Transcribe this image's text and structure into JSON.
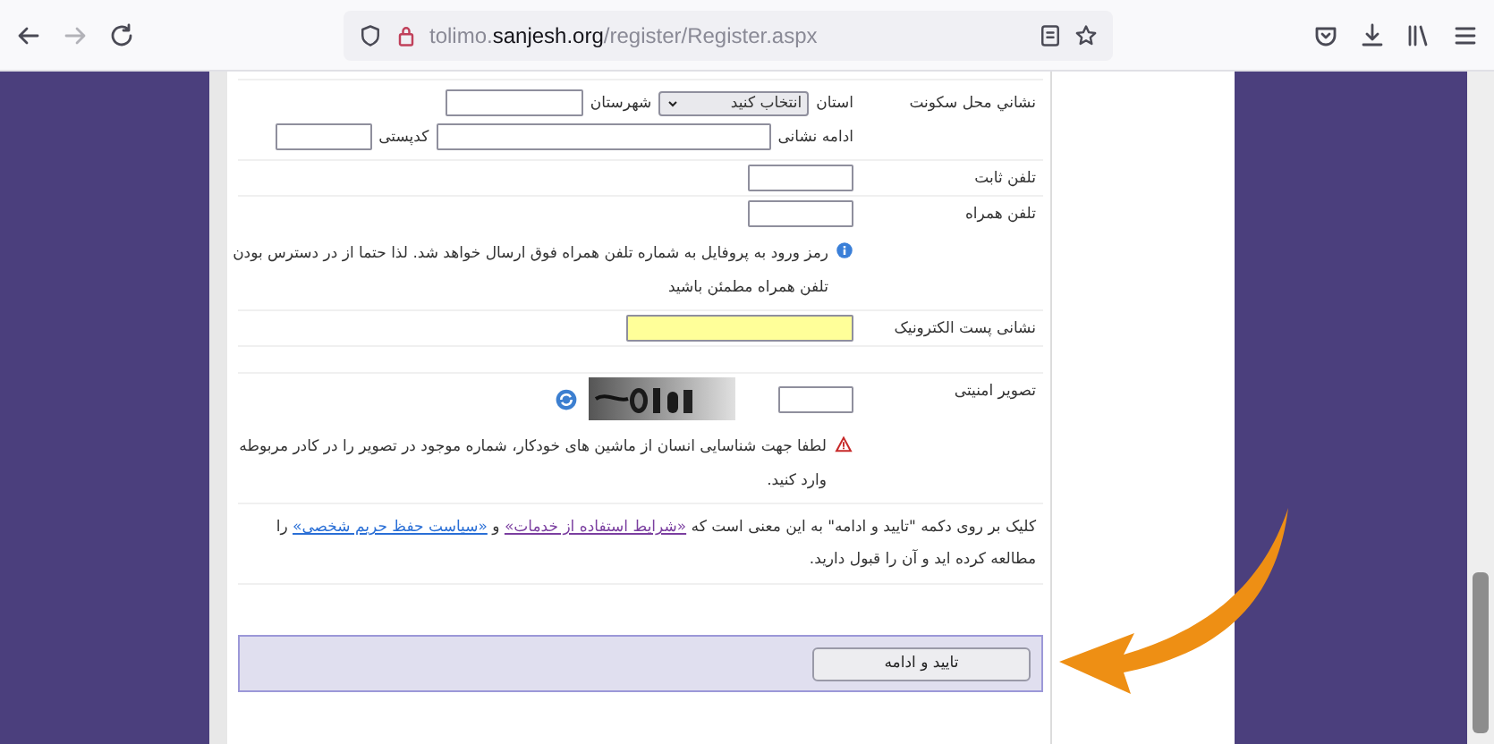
{
  "browser": {
    "url_prefix": "tolimo.",
    "url_domain": "sanjesh.org",
    "url_path": "/register/Register.aspx",
    "forward_enabled": false
  },
  "form": {
    "rows": [
      {
        "kind": "address",
        "label": "نشاني محل سکونت",
        "province_label": "استان",
        "province_select": "انتخاب کنید",
        "city_label": "شهرستان",
        "street_label": "ادامه نشانی",
        "postal_label": "کدپستی"
      },
      {
        "kind": "input",
        "label": "تلفن ثابت",
        "highlighted": false
      },
      {
        "kind": "input",
        "label": "تلفن همراه",
        "highlighted": false,
        "note": "رمز ورود به پروفایل به شماره تلفن همراه فوق ارسال خواهد شد. لذا حتما از در دسترس بودن تلفن همراه مطمئن باشید"
      },
      {
        "kind": "input",
        "label": "نشانی پست الکترونیک",
        "highlighted": true,
        "wide": true
      },
      {
        "kind": "captcha",
        "label": "تصویر امنیتی",
        "warning": "لطفا جهت شناسایی انسان از ماشین های خودکار، شماره موجود در تصویر را در کادر مربوطه وارد کنید."
      }
    ],
    "agreement": [
      {
        "kind": "text",
        "text": "کلیک بر روی دکمه \"تایید و ادامه\" به این معنی است که "
      },
      {
        "kind": "link",
        "text": "«شرایط استفاده از خدمات»",
        "visited": true
      },
      {
        "kind": "text",
        "text": " و "
      },
      {
        "kind": "link",
        "text": "«سیاست حفظ حریم شخصی»",
        "visited": false
      },
      {
        "kind": "text",
        "text": " را مطالعه کرده اید و آن را قبول دارید."
      }
    ],
    "submit_button": "تایید و ادامه"
  }
}
